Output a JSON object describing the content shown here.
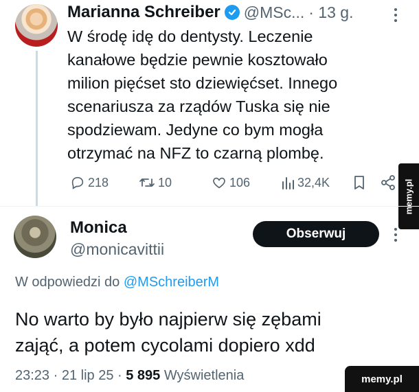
{
  "tweet": {
    "author_name": "Marianna Schreiber",
    "author_handle": "@MSc...",
    "time": "· 13 g.",
    "body_lines": [
      "W środę idę do dentysty. Leczenie",
      "kanałowe będzie pewnie kosztowało",
      "milion pięćset sto dziewięćset. Innego",
      "scenariusza za rządów Tuska się nie",
      "spodziewam. Jedyne co bym mogła",
      "otrzymać na NFZ to czarną plombę."
    ],
    "stats": {
      "replies": "218",
      "reposts": "10",
      "likes": "106",
      "views": "32,4K"
    }
  },
  "reply": {
    "author_name": "Monica",
    "author_handle": "@monicavittii",
    "follow_label": "Obserwuj",
    "reply_to_prefix": "W odpowiedzi do",
    "reply_to_handle": "@MSchreiberM",
    "body_lines": [
      "No warto by było najpierw się zębami",
      "zająć, a potem cycolami dopiero xdd"
    ],
    "time": "23:23 · 21 lip 25 ·",
    "views_count": "5 895",
    "views_label": "Wyświetlenia"
  },
  "watermarks": {
    "side": "memy.pl",
    "corner": "memy.pl"
  },
  "colors": {
    "text": "#0f1419",
    "secondary": "#536471",
    "accent": "#1d9bf0",
    "button_bg": "#0f1419"
  },
  "icons": [
    "verified-badge-icon",
    "more-options-icon",
    "reply-icon",
    "repost-icon",
    "like-icon",
    "views-icon",
    "bookmark-icon",
    "share-icon"
  ]
}
